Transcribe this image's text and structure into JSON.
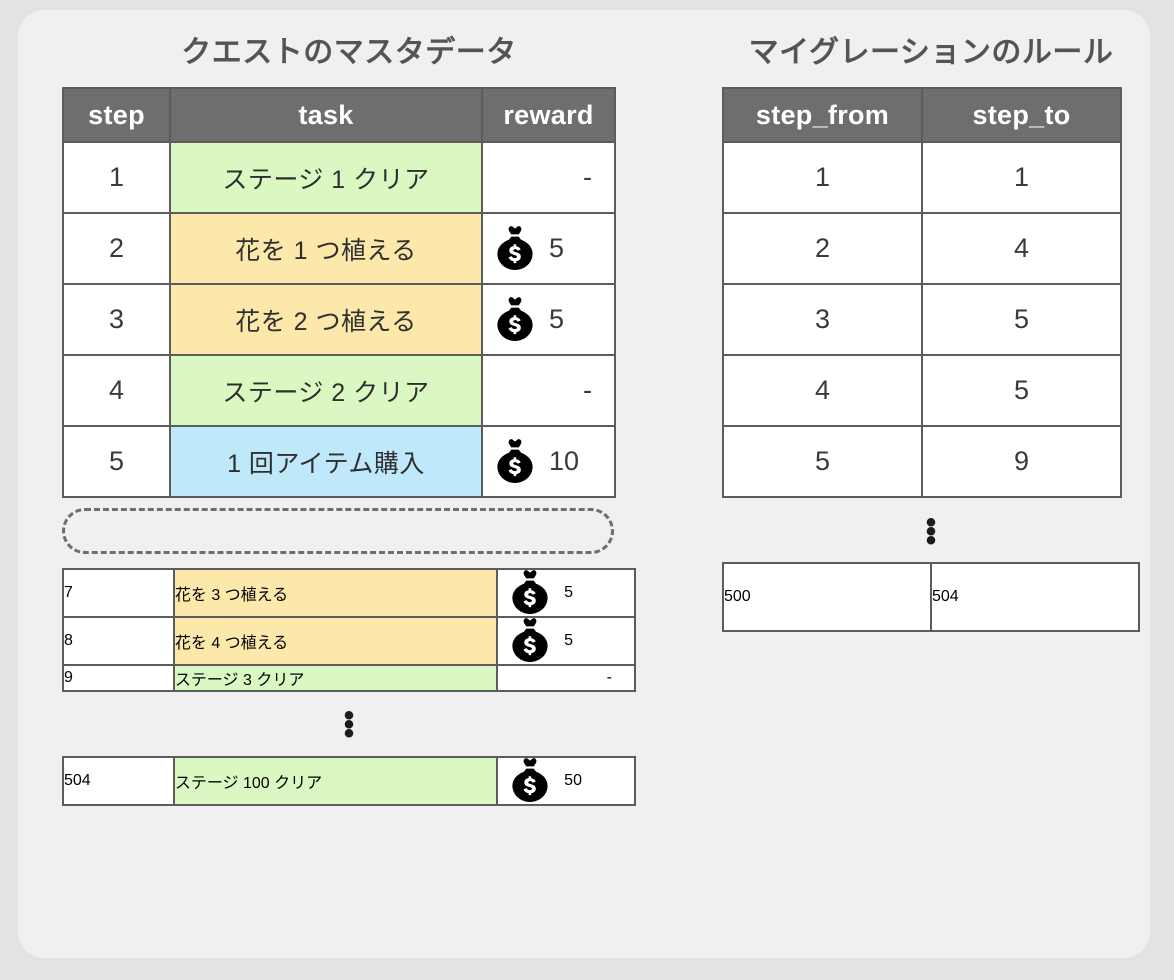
{
  "card": {
    "background": "#eff0ef",
    "page_background": "#e3e3e3"
  },
  "colors": {
    "header_bg": "#6e6e6e",
    "border": "#5c5c5c",
    "title_text": "#545454",
    "stage_cell": "#dbf7c2",
    "flower_cell": "#fce8ab",
    "item_cell": "#bfe8fb"
  },
  "quest_panel": {
    "title": "クエストのマスタデータ",
    "columns": [
      "step",
      "task",
      "reward"
    ],
    "rows_block1": [
      {
        "step": "1",
        "task": "ステージ 1 クリア",
        "task_color": "green",
        "reward": "-",
        "has_icon": false
      },
      {
        "step": "2",
        "task": "花を 1 つ植える",
        "task_color": "amber",
        "reward": "5",
        "has_icon": true
      },
      {
        "step": "3",
        "task": "花を 2 つ植える",
        "task_color": "amber",
        "reward": "5",
        "has_icon": true
      },
      {
        "step": "4",
        "task": "ステージ 2 クリア",
        "task_color": "green",
        "reward": "-",
        "has_icon": false
      },
      {
        "step": "5",
        "task": "1 回アイテム購入",
        "task_color": "blue",
        "reward": "10",
        "has_icon": true
      }
    ],
    "gap1_style": "dashed-rounded-box",
    "rows_block2": [
      {
        "step": "7",
        "task": "花を 3 つ植える",
        "task_color": "amber",
        "reward": "5",
        "has_icon": true
      },
      {
        "step": "8",
        "task": "花を 4 つ植える",
        "task_color": "amber",
        "reward": "5",
        "has_icon": true
      },
      {
        "step": "9",
        "task": "ステージ 3 クリア",
        "task_color": "green",
        "reward": "-",
        "has_icon": false
      }
    ],
    "gap2_style": "vertical-ellipsis",
    "gap2_glyph": "•",
    "rows_block3": [
      {
        "step": "504",
        "task": "ステージ 100 クリア",
        "task_color": "green",
        "reward": "50",
        "has_icon": true
      }
    ]
  },
  "migration_panel": {
    "title": "マイグレーションのルール",
    "columns": [
      "step_from",
      "step_to"
    ],
    "rows_block1": [
      {
        "step_from": "1",
        "step_to": "1"
      },
      {
        "step_from": "2",
        "step_to": "4"
      },
      {
        "step_from": "3",
        "step_to": "5"
      },
      {
        "step_from": "4",
        "step_to": "5"
      },
      {
        "step_from": "5",
        "step_to": "9"
      }
    ],
    "gap_style": "vertical-ellipsis",
    "gap_glyph": "•",
    "rows_block2": [
      {
        "step_from": "500",
        "step_to": "504"
      }
    ]
  },
  "icons": {
    "money_bag": "money-bag-icon"
  }
}
